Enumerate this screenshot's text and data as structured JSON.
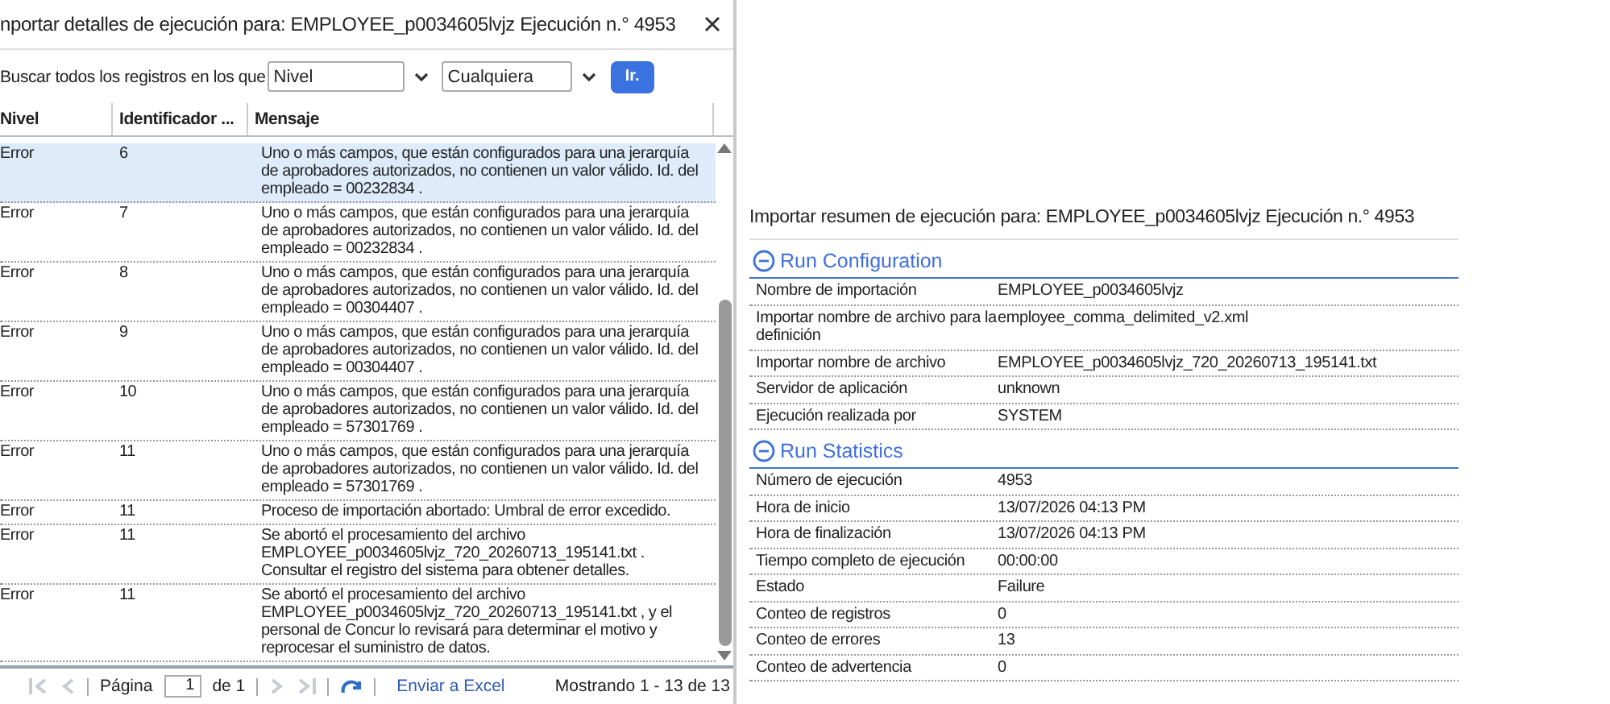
{
  "details_dialog": {
    "title": "nportar detalles de ejecución para: EMPLOYEE_p0034605lvjz Ejecución n.° 4953",
    "search": {
      "label": "Buscar todos los registros en los que",
      "field": "Nivel",
      "operator": "Cualquiera",
      "button": "Ir."
    },
    "table": {
      "columns": [
        "Nivel",
        "Identificador ...",
        "Mensaje"
      ],
      "rows": [
        {
          "level": "Error",
          "id": "6",
          "message": "Uno o más campos, que están configurados para una jerarquía de aprobadores autorizados, no contienen un valor válido. Id. del empleado = 00232834 .",
          "selected": true
        },
        {
          "level": "Error",
          "id": "7",
          "message": "Uno o más campos, que están configurados para una jerarquía de aprobadores autorizados, no contienen un valor válido. Id. del empleado = 00232834 .",
          "selected": false
        },
        {
          "level": "Error",
          "id": "8",
          "message": "Uno o más campos, que están configurados para una jerarquía de aprobadores autorizados, no contienen un valor válido. Id. del empleado = 00304407 .",
          "selected": false
        },
        {
          "level": "Error",
          "id": "9",
          "message": "Uno o más campos, que están configurados para una jerarquía de aprobadores autorizados, no contienen un valor válido. Id. del empleado = 00304407 .",
          "selected": false
        },
        {
          "level": "Error",
          "id": "10",
          "message": "Uno o más campos, que están configurados para una jerarquía de aprobadores autorizados, no contienen un valor válido. Id. del empleado = 57301769 .",
          "selected": false
        },
        {
          "level": "Error",
          "id": "11",
          "message": "Uno o más campos, que están configurados para una jerarquía de aprobadores autorizados, no contienen un valor válido. Id. del empleado = 57301769 .",
          "selected": false
        },
        {
          "level": "Error",
          "id": "11",
          "message": "Proceso de importación abortado: Umbral de error excedido.",
          "selected": false
        },
        {
          "level": "Error",
          "id": "11",
          "message": "Se abortó el procesamiento del archivo EMPLOYEE_p0034605lvjz_720_20260713_195141.txt . Consultar el registro del sistema para obtener detalles.",
          "selected": false
        },
        {
          "level": "Error",
          "id": "11",
          "message": "Se abortó el procesamiento del archivo EMPLOYEE_p0034605lvjz_720_20260713_195141.txt , y el personal de Concur lo revisará para determinar el motivo y reprocesar el suministro de datos.",
          "selected": false
        }
      ]
    },
    "pager": {
      "page_label": "Página",
      "page": "1",
      "of": "de 1",
      "export": "Enviar a Excel",
      "showing": "Mostrando 1 - 13 de 13"
    }
  },
  "summary": {
    "title": "Importar resumen de ejecución para: EMPLOYEE_p0034605lvjz Ejecución n.° 4953",
    "sections": [
      {
        "title": "Run Configuration",
        "expanded": true,
        "rows": [
          {
            "label": "Nombre de importación",
            "value": "EMPLOYEE_p0034605lvjz"
          },
          {
            "label": "Importar nombre de archivo para la definición",
            "value": "employee_comma_delimited_v2.xml"
          },
          {
            "label": "Importar nombre de archivo",
            "value": "EMPLOYEE_p0034605lvjz_720_20260713_195141.txt"
          },
          {
            "label": "Servidor de aplicación",
            "value": "unknown"
          },
          {
            "label": "Ejecución realizada por",
            "value": "SYSTEM"
          }
        ]
      },
      {
        "title": "Run Statistics",
        "expanded": true,
        "rows": [
          {
            "label": "Número de ejecución",
            "value": "4953"
          },
          {
            "label": "Hora de inicio",
            "value": "13/07/2026 04:13 PM"
          },
          {
            "label": "Hora de finalización",
            "value": "13/07/2026 04:13 PM"
          },
          {
            "label": "Tiempo completo de ejecución",
            "value": "00:00:00"
          },
          {
            "label": "Estado",
            "value": "Failure"
          },
          {
            "label": "Conteo de registros",
            "value": "0"
          },
          {
            "label": "Conteo de errores",
            "value": "13"
          },
          {
            "label": "Conteo de advertencia",
            "value": "0"
          }
        ]
      }
    ]
  }
}
